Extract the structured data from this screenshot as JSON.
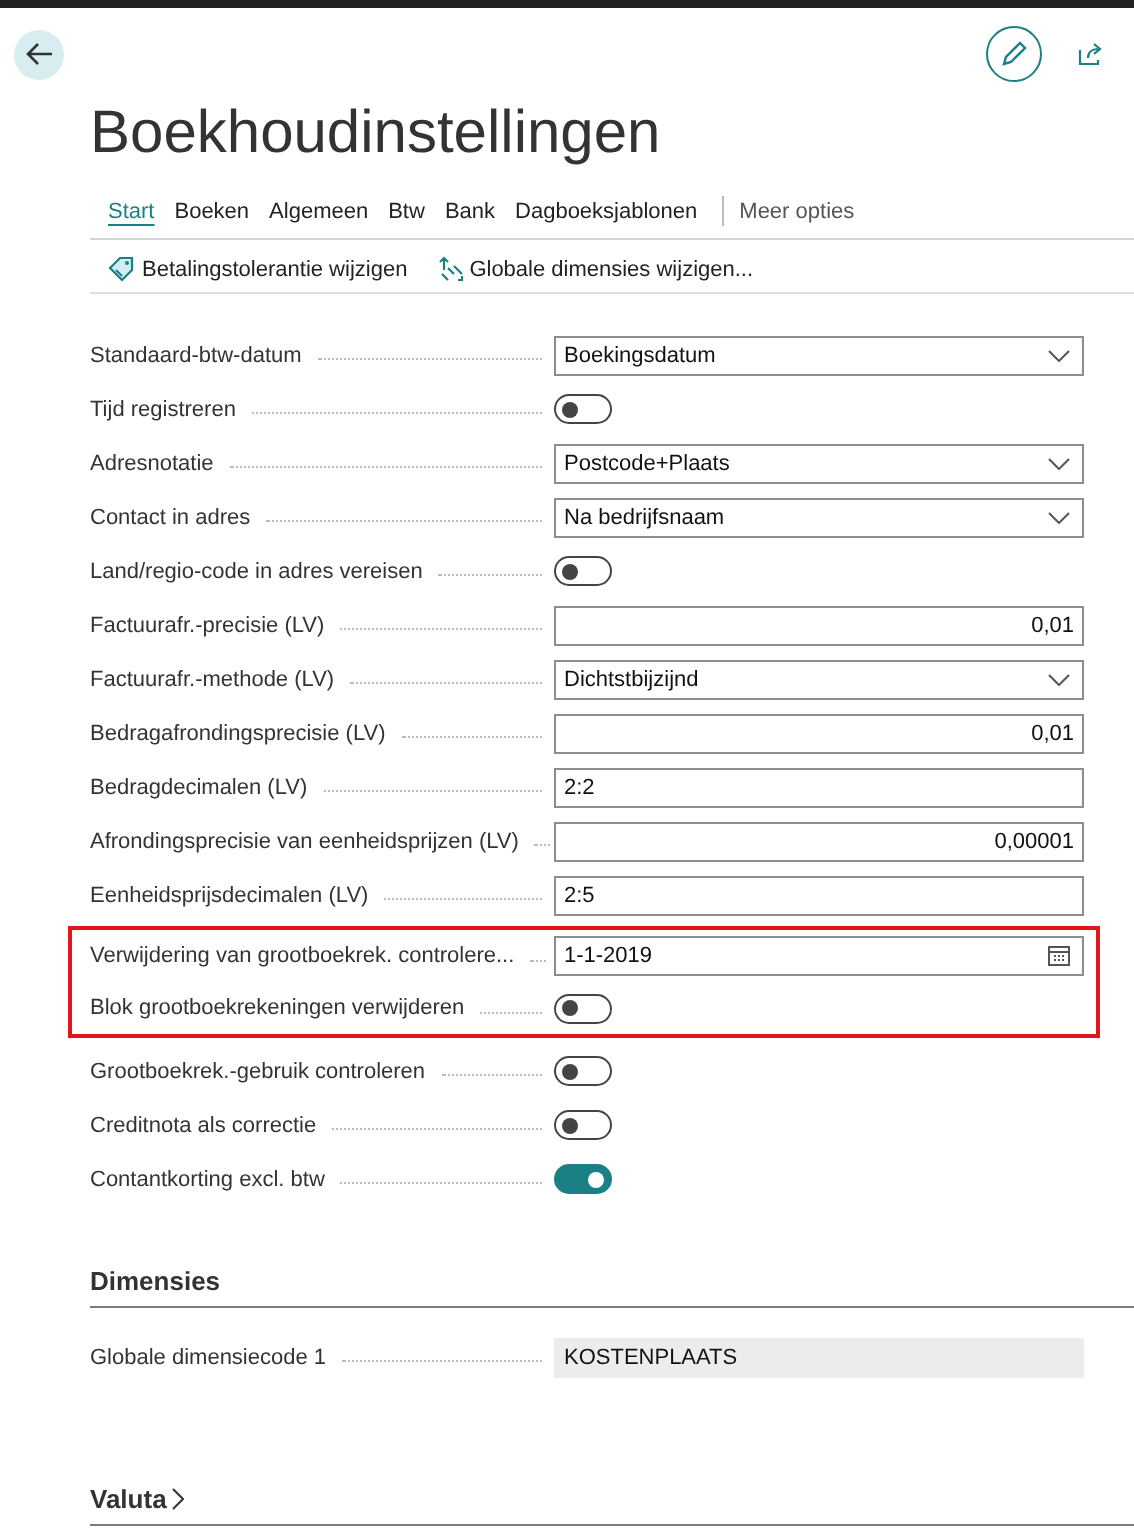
{
  "page": {
    "title": "Boekhoudinstellingen"
  },
  "tabs": [
    {
      "label": "Start",
      "selected": true
    },
    {
      "label": "Boeken",
      "selected": false
    },
    {
      "label": "Algemeen",
      "selected": false
    },
    {
      "label": "Btw",
      "selected": false
    },
    {
      "label": "Bank",
      "selected": false
    },
    {
      "label": "Dagboeksjablonen",
      "selected": false
    }
  ],
  "more_options": "Meer opties",
  "actions": [
    {
      "kind": "tolerance",
      "label": "Betalingstolerantie wijzigen"
    },
    {
      "kind": "dimensions",
      "label": "Globale dimensies wijzigen..."
    }
  ],
  "fields": [
    {
      "label": "Standaard-btw-datum",
      "kind": "dropdown",
      "value": "Boekingsdatum",
      "highlighted": false
    },
    {
      "label": "Tijd registreren",
      "kind": "toggle",
      "on": false,
      "highlighted": false
    },
    {
      "label": "Adresnotatie",
      "kind": "dropdown",
      "value": "Postcode+Plaats",
      "highlighted": false
    },
    {
      "label": "Contact in adres",
      "kind": "dropdown",
      "value": "Na bedrijfsnaam",
      "highlighted": false
    },
    {
      "label": "Land/regio-code in adres vereisen",
      "kind": "toggle",
      "on": false,
      "highlighted": false
    },
    {
      "label": "Factuurafr.-precisie (LV)",
      "kind": "number",
      "value": "0,01",
      "highlighted": false
    },
    {
      "label": "Factuurafr.-methode (LV)",
      "kind": "dropdown",
      "value": "Dichtstbijzijnd",
      "highlighted": false
    },
    {
      "label": "Bedragafrondingsprecisie (LV)",
      "kind": "number",
      "value": "0,01",
      "highlighted": false
    },
    {
      "label": "Bedragdecimalen (LV)",
      "kind": "text",
      "value": "2:2",
      "highlighted": false
    },
    {
      "label": "Afrondingsprecisie van eenheidsprijzen (LV)",
      "kind": "number",
      "value": "0,00001",
      "highlighted": false
    },
    {
      "label": "Eenheidsprijsdecimalen (LV)",
      "kind": "text",
      "value": "2:5",
      "highlighted": false
    },
    {
      "label": "Verwijdering van grootboekrek. controlere...",
      "kind": "date",
      "value": "1-1-2019",
      "highlighted": true
    },
    {
      "label": "Blok grootboekrekeningen verwijderen",
      "kind": "toggle",
      "on": false,
      "highlighted": true
    },
    {
      "label": "Grootboekrek.-gebruik controleren",
      "kind": "toggle",
      "on": false,
      "highlighted": false
    },
    {
      "label": "Creditnota als correctie",
      "kind": "toggle",
      "on": false,
      "highlighted": false
    },
    {
      "label": "Contantkorting excl. btw",
      "kind": "toggle",
      "on": true,
      "highlighted": false
    }
  ],
  "sections": [
    {
      "title": "Dimensies",
      "expanded": true,
      "fields": [
        {
          "label": "Globale dimensiecode 1",
          "kind": "readonly",
          "value": "KOSTENPLAATS"
        }
      ]
    },
    {
      "title": "Valuta",
      "expanded": false
    }
  ]
}
